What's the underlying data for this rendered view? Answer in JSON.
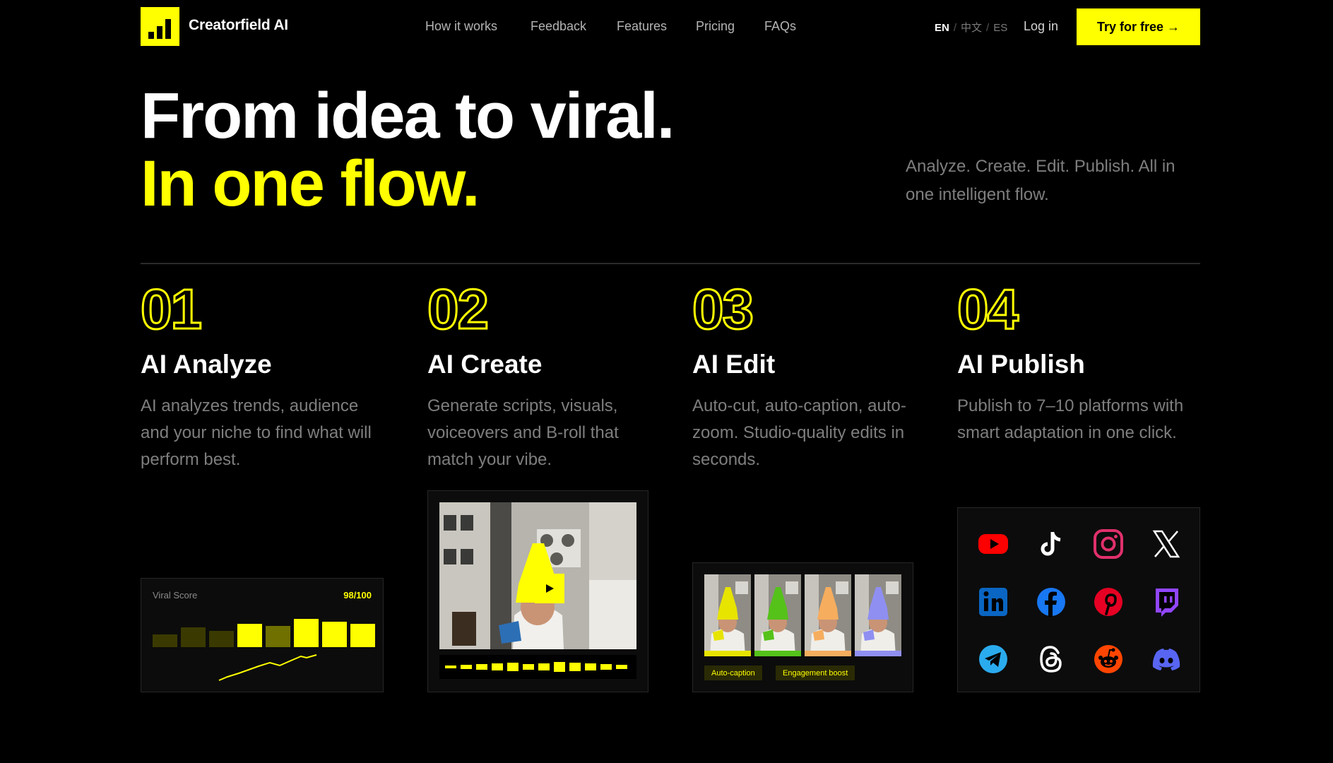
{
  "brand": {
    "name": "Creatorfield AI"
  },
  "nav": {
    "items": [
      "How it works",
      "Feedback",
      "Features",
      "Pricing",
      "FAQs"
    ]
  },
  "lang": {
    "active": "EN",
    "others": [
      "中文",
      "ES"
    ],
    "separator": "/"
  },
  "auth": {
    "login": "Log in",
    "cta": "Try for free →"
  },
  "hero": {
    "line1": "From idea to viral.",
    "line2": "In one flow.",
    "tagline": "Analyze. Create. Edit. Publish. All in one intelligent flow."
  },
  "steps": [
    {
      "num": "01",
      "title": "AI Analyze",
      "desc": "AI analyzes trends, audience and your niche to find what will perform best."
    },
    {
      "num": "02",
      "title": "AI Create",
      "desc": "Generate scripts, visuals, voiceovers and B-roll that match your vibe."
    },
    {
      "num": "03",
      "title": "AI Edit",
      "desc": "Auto-cut, auto-caption, auto-zoom. Studio-quality edits in seconds."
    },
    {
      "num": "04",
      "title": "AI Publish",
      "desc": "Publish to 7–10 platforms with smart adaptation in one click."
    }
  ],
  "viral": {
    "label": "Viral Score",
    "score": "98/100",
    "bars": [
      0.35,
      0.55,
      0.45,
      0.65,
      0.6,
      0.8,
      0.72,
      0.65
    ],
    "bar_colors": [
      "#3a3a00",
      "#3a3a00",
      "#3a3a00",
      "#ffff00",
      "#707000",
      "#ffff00",
      "#ffff00",
      "#ffff00"
    ]
  },
  "edit": {
    "tags": [
      "Auto-caption",
      "Engagement boost"
    ],
    "hat_colors": [
      "#e7e400",
      "#55c21a",
      "#f6ad5e",
      "#8f8ff2"
    ]
  },
  "platforms": [
    "youtube",
    "tiktok",
    "instagram",
    "x",
    "linkedin",
    "facebook",
    "pinterest",
    "twitch",
    "telegram",
    "threads",
    "reddit",
    "discord"
  ],
  "colors": {
    "accent": "#ffff00",
    "background": "#000000",
    "muted": "#7e7e7e"
  }
}
